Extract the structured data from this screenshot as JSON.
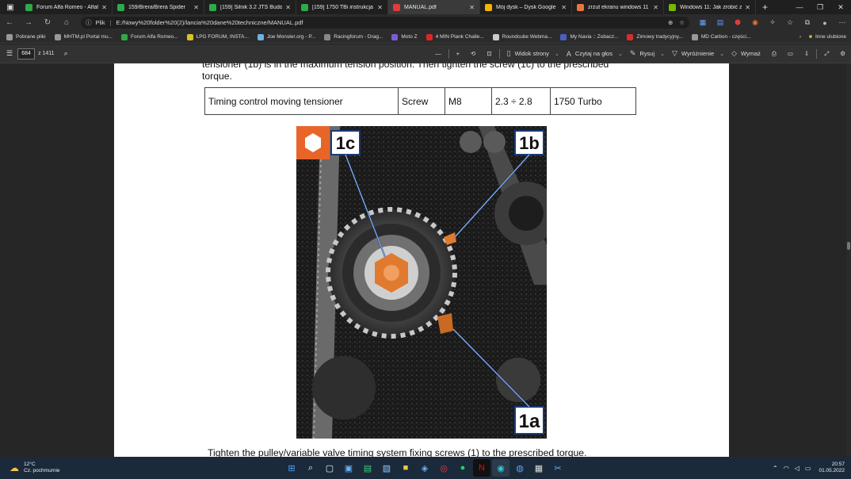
{
  "tabs": [
    {
      "label": "Forum Alfa Romeo - Alfaholic",
      "color": "#2eaa4a"
    },
    {
      "label": "159/Brera/Brera Spider",
      "color": "#2eaa4a"
    },
    {
      "label": "[159] Silnik 3.2 JTS Budowa",
      "color": "#2eaa4a"
    },
    {
      "label": "[159] 1750 TBi instrukcja w",
      "color": "#2eaa4a"
    },
    {
      "label": "MANUAL.pdf",
      "color": "#e23b3b",
      "active": true
    },
    {
      "label": "Mój dysk – Dysk Google",
      "color": "#f4b400"
    },
    {
      "label": "zrzut ekranu windows 11 –",
      "color": "#e8763a"
    },
    {
      "label": "Windows 11: Jak zrobić zrz",
      "color": "#76b900"
    }
  ],
  "address": {
    "scheme_label": "Plik",
    "url": "E:/Nowy%20folder%20(2)/lancia%20dane%20techniczne/MANUAL.pdf"
  },
  "bookmarks": [
    {
      "label": "Pobrane pliki",
      "color": "#999"
    },
    {
      "label": "MHTM.pl Portal mu...",
      "color": "#999"
    },
    {
      "label": "Forum Alfa Romeo...",
      "color": "#2eaa4a"
    },
    {
      "label": "LPG FORUM, INSTA...",
      "color": "#d9c12a"
    },
    {
      "label": "Joe Monster.org - P...",
      "color": "#6bb3e0"
    },
    {
      "label": "Racingforum - Drag...",
      "color": "#888"
    },
    {
      "label": "Moto Z",
      "color": "#7a5cd6"
    },
    {
      "label": "4 MIN Plank Challe...",
      "color": "#e02424"
    },
    {
      "label": "Roundcube Webma...",
      "color": "#cccccc"
    },
    {
      "label": "My Navia :: Zobacz...",
      "color": "#4a5fc4"
    },
    {
      "label": "Zimowy tradycyjny...",
      "color": "#d62d2d"
    },
    {
      "label": "MD Carbon - części...",
      "color": "#999"
    }
  ],
  "bookmarks_other": "Inne ulubione",
  "pdf": {
    "page_number": "684",
    "page_count": "z 1411",
    "tools": [
      {
        "label": "Widok strony",
        "icon": "page-view-icon"
      },
      {
        "label": "Czytaj na głos",
        "icon": "read-aloud-icon"
      },
      {
        "label": "Rysuj",
        "icon": "draw-icon"
      },
      {
        "label": "Wyróżnienie",
        "icon": "highlight-icon"
      },
      {
        "label": "Wymaż",
        "icon": "erase-icon"
      }
    ]
  },
  "document": {
    "top_text_line1": "tensioner (1b) is in the maximum tension position. Then tighten the screw (1c) to the prescribed",
    "top_text_line2": "torque.",
    "table_row": [
      "Timing control moving tensioner",
      "Screw",
      "M8",
      "2.3 ÷ 2.8",
      "1750 Turbo"
    ],
    "callouts": [
      "1c",
      "1b",
      "1a"
    ],
    "bottom_text": "Tighten the pulley/variable valve timing system fixing screws (1) to the prescribed torque."
  },
  "taskbar": {
    "temperature": "12°C",
    "weather": "Cz. pochmurnie",
    "time": "20:57",
    "date": "01.05.2022"
  }
}
